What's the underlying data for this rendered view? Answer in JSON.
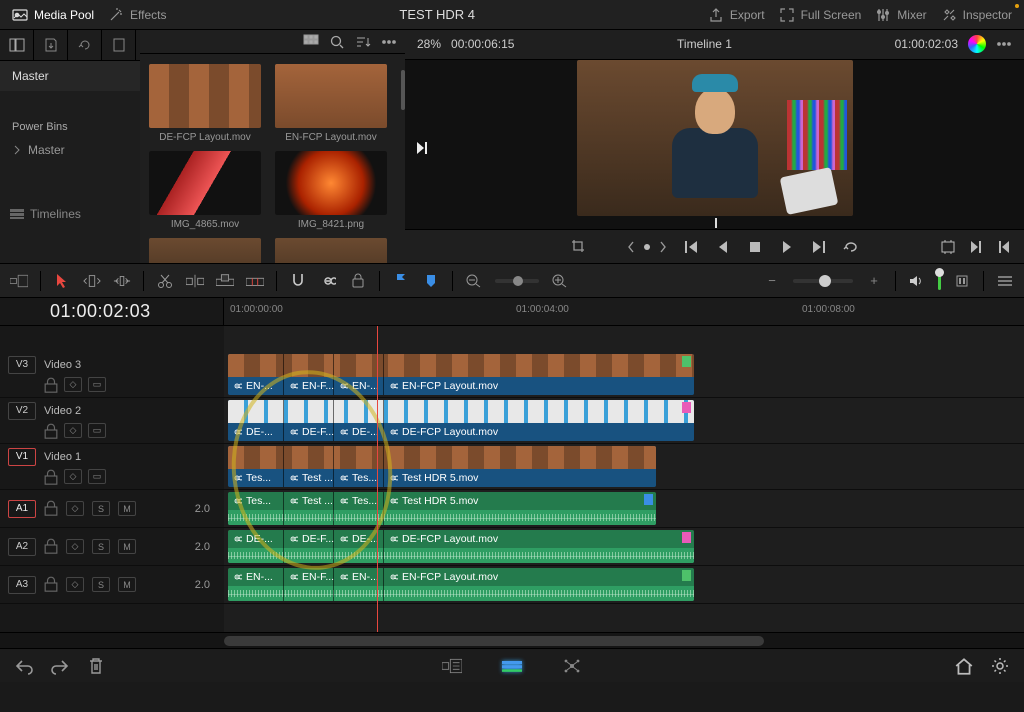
{
  "menubar": {
    "media_pool": "Media Pool",
    "effects": "Effects",
    "title": "TEST HDR 4",
    "export": "Export",
    "full_screen": "Full Screen",
    "mixer": "Mixer",
    "inspector": "Inspector"
  },
  "pool": {
    "master": "Master",
    "power_bins": "Power Bins",
    "bin_master": "Master",
    "timelines": "Timelines",
    "clips": [
      {
        "name": "DE-FCP Layout.mov",
        "tag": "#e24"
      },
      {
        "name": "EN-FCP Layout.mov",
        "tag": "#5c5"
      },
      {
        "name": "IMG_4865.mov",
        "tag": ""
      },
      {
        "name": "IMG_8421.png",
        "tag": "#e24"
      }
    ]
  },
  "viewer": {
    "zoom": "28%",
    "tc_left": "00:00:06:15",
    "timeline_name": "Timeline 1",
    "tc_right": "01:00:02:03"
  },
  "timeline": {
    "tc": "01:00:02:03",
    "ruler": [
      "01:00:00:00",
      "01:00:04:00",
      "01:00:08:00"
    ],
    "tracks": {
      "v3": {
        "label": "V3",
        "name": "Video 3"
      },
      "v2": {
        "label": "V2",
        "name": "Video 2"
      },
      "v1": {
        "label": "V1",
        "name": "Video 1"
      },
      "a1": {
        "label": "A1",
        "gain": "2.0"
      },
      "a2": {
        "label": "A2",
        "gain": "2.0"
      },
      "a3": {
        "label": "A3",
        "gain": "2.0"
      }
    },
    "seg_short": {
      "enf": "EN-F...",
      "def": "DE-F...",
      "tes": "Test ...",
      "en": "EN-...",
      "de": "DE-...",
      "tesd": "Tes..."
    },
    "clips": {
      "v3_main": "EN-FCP Layout.mov",
      "v2_main": "DE-FCP Layout.mov",
      "v1_main": "Test HDR 5.mov",
      "a1_main": "Test HDR 5.mov",
      "a2_main": "DE-FCP Layout.mov",
      "a3_main": "EN-FCP Layout.mov"
    },
    "mini": {
      "s": "S",
      "m": "M"
    }
  },
  "colors": {
    "flag_green": "#4ec16a",
    "flag_pink": "#e85bb8",
    "flag_blue": "#3a8ee6",
    "playhead": "#e8473f"
  }
}
